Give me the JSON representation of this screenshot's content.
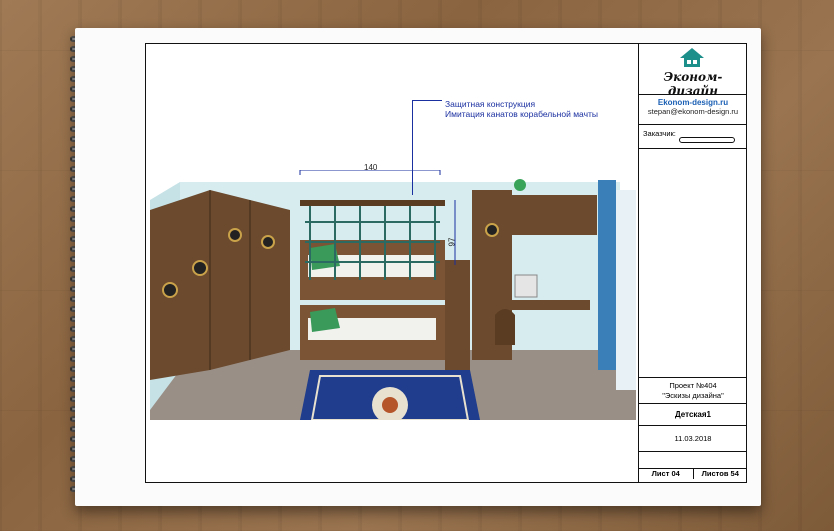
{
  "titleblock": {
    "brand": "Эконом-дизайн",
    "site": "Ekonom-design.ru",
    "email": "stepan@ekonom-design.ru",
    "client_label": "Заказчик:",
    "project_line1": "Проект №404",
    "project_line2": "\"Эскизы дизайна\"",
    "sheet_name": "Детская1",
    "date": "11.03.2018",
    "sheet_label": "Лист  04",
    "sheets_label": "Листов 54"
  },
  "annotation": {
    "line1": "Защитная конструкция",
    "line2": "Имитация канатов корабельной мачты"
  },
  "dimensions": {
    "width": "140",
    "height": "97"
  },
  "colors": {
    "accent": "#1a5fb4",
    "annotation": "#1a2fa0",
    "wood": "#6b4a2e",
    "rug": "#1f3d8c"
  }
}
